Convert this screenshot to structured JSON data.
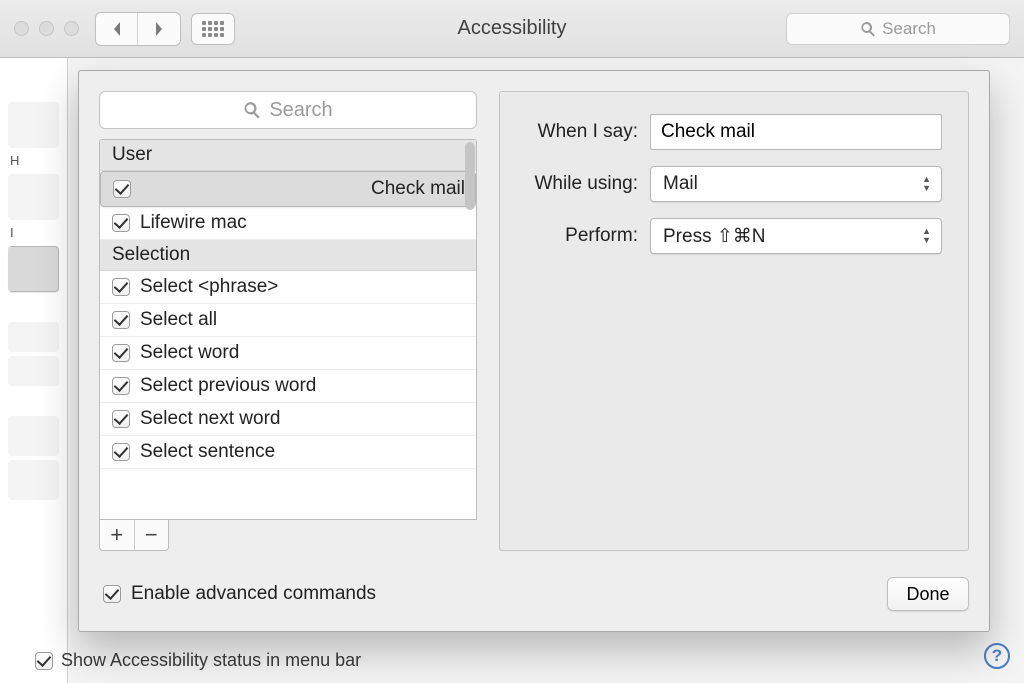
{
  "window": {
    "title": "Accessibility",
    "toolbar_search_placeholder": "Search"
  },
  "sheet": {
    "search_placeholder": "Search",
    "groups": [
      {
        "name": "User",
        "items": [
          {
            "label": "Check mail",
            "checked": true,
            "selected": true
          },
          {
            "label": "Lifewire mac",
            "checked": true,
            "selected": false
          }
        ]
      },
      {
        "name": "Selection",
        "items": [
          {
            "label": "Select <phrase>",
            "checked": true,
            "selected": false
          },
          {
            "label": "Select all",
            "checked": true,
            "selected": false
          },
          {
            "label": "Select word",
            "checked": true,
            "selected": false
          },
          {
            "label": "Select previous word",
            "checked": true,
            "selected": false
          },
          {
            "label": "Select next word",
            "checked": true,
            "selected": false
          },
          {
            "label": "Select sentence",
            "checked": true,
            "selected": false
          }
        ]
      }
    ],
    "form": {
      "when_label": "When I say:",
      "when_value": "Check mail",
      "while_label": "While using:",
      "while_value": "Mail",
      "perform_label": "Perform:",
      "perform_value": "Press ⇧⌘N"
    },
    "enable_advanced_label": "Enable advanced commands",
    "enable_advanced_checked": true,
    "done_label": "Done"
  },
  "footer": {
    "show_status_label": "Show Accessibility status in menu bar",
    "show_status_checked": true,
    "help": "?"
  },
  "hidden_sidebar_letters": {
    "a": "H",
    "b": "I"
  }
}
